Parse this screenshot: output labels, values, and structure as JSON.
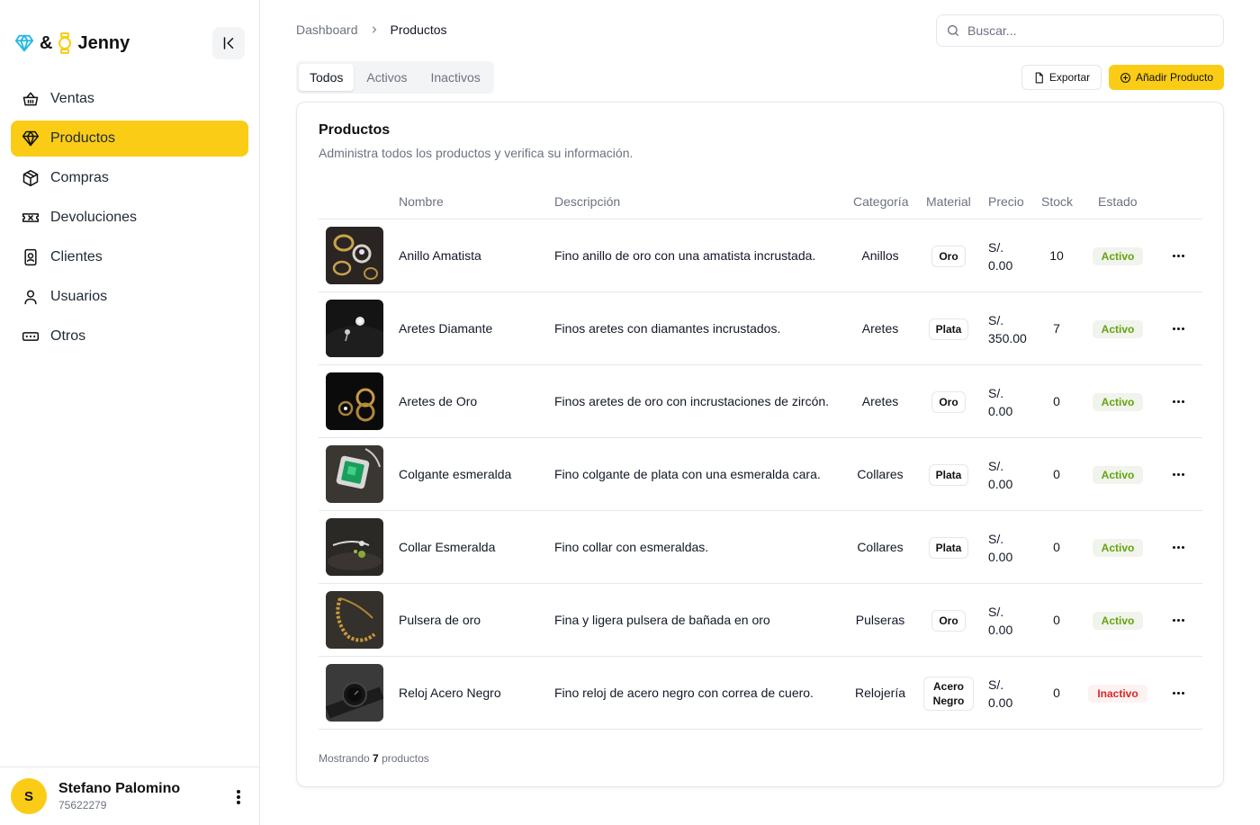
{
  "brand": {
    "ampersand": "&",
    "name": "Jenny",
    "accent": "#facc15"
  },
  "sidebar": {
    "items": [
      {
        "label": "Ventas",
        "icon": "basket-icon"
      },
      {
        "label": "Productos",
        "icon": "gem-icon",
        "active": true
      },
      {
        "label": "Compras",
        "icon": "package-icon"
      },
      {
        "label": "Devoluciones",
        "icon": "ticket-x-icon"
      },
      {
        "label": "Clientes",
        "icon": "contact-book-icon"
      },
      {
        "label": "Usuarios",
        "icon": "user-icon"
      },
      {
        "label": "Otros",
        "icon": "rectangle-ellipsis-icon"
      }
    ]
  },
  "user": {
    "initial": "S",
    "name": "Stefano Palomino",
    "id": "75622279"
  },
  "breadcrumb": {
    "root": "Dashboard",
    "current": "Productos"
  },
  "search": {
    "placeholder": "Buscar..."
  },
  "tabs": [
    "Todos",
    "Activos",
    "Inactivos"
  ],
  "toolbar": {
    "export_label": "Exportar",
    "add_label": "Añadir Producto"
  },
  "card": {
    "title": "Productos",
    "subtitle": "Administra todos los productos y verifica su información."
  },
  "table": {
    "columns": [
      "Nombre",
      "Descripción",
      "Categoría",
      "Material",
      "Precio",
      "Stock",
      "Estado"
    ],
    "rows": [
      {
        "name": "Anillo Amatista",
        "desc": "Fino anillo de oro con una amatista incrustada.",
        "cat": "Anillos",
        "mat": "Oro",
        "price_cur": "S/.",
        "price": "0.00",
        "stock": "10",
        "status": "Activo"
      },
      {
        "name": "Aretes Diamante",
        "desc": "Finos aretes con diamantes incrustados.",
        "cat": "Aretes",
        "mat": "Plata",
        "price_cur": "S/.",
        "price": "350.00",
        "stock": "7",
        "status": "Activo"
      },
      {
        "name": "Aretes de Oro",
        "desc": "Finos aretes de oro con incrustaciones de zircón.",
        "cat": "Aretes",
        "mat": "Oro",
        "price_cur": "S/.",
        "price": "0.00",
        "stock": "0",
        "status": "Activo"
      },
      {
        "name": "Colgante esmeralda",
        "desc": "Fino colgante de plata con una esmeralda cara.",
        "cat": "Collares",
        "mat": "Plata",
        "price_cur": "S/.",
        "price": "0.00",
        "stock": "0",
        "status": "Activo"
      },
      {
        "name": "Collar Esmeralda",
        "desc": "Fino collar con esmeraldas.",
        "cat": "Collares",
        "mat": "Plata",
        "price_cur": "S/.",
        "price": "0.00",
        "stock": "0",
        "status": "Activo"
      },
      {
        "name": "Pulsera de oro",
        "desc": "Fina y ligera pulsera de bañada en oro",
        "cat": "Pulseras",
        "mat": "Oro",
        "price_cur": "S/.",
        "price": "0.00",
        "stock": "0",
        "status": "Activo"
      },
      {
        "name": "Reloj Acero Negro",
        "desc": "Fino reloj de acero negro con correa de cuero.",
        "cat": "Relojería",
        "mat": "Acero Negro",
        "price_cur": "S/.",
        "price": "0.00",
        "stock": "0",
        "status": "Inactivo"
      }
    ]
  },
  "footer": {
    "prefix": "Mostrando",
    "count": "7",
    "suffix": "productos"
  }
}
